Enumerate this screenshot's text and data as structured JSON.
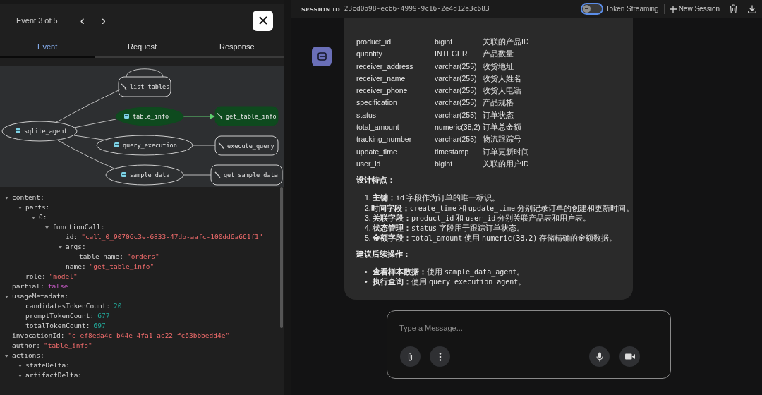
{
  "event_panel": {
    "counter": "Event 3 of 5",
    "prev": "‹",
    "next": "›",
    "tabs": [
      {
        "label": "Event",
        "selected": true
      },
      {
        "label": "Request",
        "selected": false
      },
      {
        "label": "Response",
        "selected": false
      }
    ],
    "graph_nodes": [
      {
        "label": "sqlite_agent",
        "kind": "agent",
        "selected": false
      },
      {
        "label": "list_tables",
        "kind": "tool",
        "selected": false
      },
      {
        "label": "table_info",
        "kind": "agent",
        "selected": true
      },
      {
        "label": "get_table_info",
        "kind": "tool",
        "selected": true
      },
      {
        "label": "query_execution",
        "kind": "agent",
        "selected": false
      },
      {
        "label": "execute_query",
        "kind": "tool",
        "selected": false
      },
      {
        "label": "sample_data",
        "kind": "agent",
        "selected": false
      },
      {
        "label": "get_sample_data",
        "kind": "tool",
        "selected": false
      }
    ],
    "json_tree": [
      {
        "key": "content:",
        "expanded": true,
        "children": [
          {
            "key": "parts:",
            "expanded": true,
            "children": [
              {
                "key": "0:",
                "expanded": true,
                "children": [
                  {
                    "key": "functionCall:",
                    "expanded": true,
                    "children": [
                      {
                        "key": "id:",
                        "value": "\"call_0_90706c3e-6833-47db-aafc-100dd6a661f1\"",
                        "kind": "string"
                      },
                      {
                        "key": "args:",
                        "expanded": true,
                        "children": [
                          {
                            "key": "table_name:",
                            "value": "\"orders\"",
                            "kind": "string"
                          }
                        ]
                      },
                      {
                        "key": "name:",
                        "value": "\"get_table_info\"",
                        "kind": "string"
                      }
                    ]
                  }
                ]
              }
            ]
          },
          {
            "key": "role:",
            "value": "\"model\"",
            "kind": "string"
          }
        ]
      },
      {
        "key": "partial:",
        "value": "false",
        "kind": "boolean"
      },
      {
        "key": "usageMetadata:",
        "expanded": true,
        "children": [
          {
            "key": "candidatesTokenCount:",
            "value": "20",
            "kind": "number"
          },
          {
            "key": "promptTokenCount:",
            "value": "677",
            "kind": "number"
          },
          {
            "key": "totalTokenCount:",
            "value": "697",
            "kind": "number"
          }
        ]
      },
      {
        "key": "invocationId:",
        "value": "\"e-ef8eda4c-b44e-4fa1-ae22-fc63bbbedd4e\"",
        "kind": "string"
      },
      {
        "key": "author:",
        "value": "\"table_info\"",
        "kind": "string"
      },
      {
        "key": "actions:",
        "expanded": true,
        "children": [
          {
            "key": "stateDelta:",
            "expanded": true
          },
          {
            "key": "artifactDelta:",
            "expanded": true
          }
        ]
      }
    ]
  },
  "top_bar": {
    "session_label": "SESSION ID",
    "session_id": "23cd0b98-ecb6-4999-9c16-2e4d12e3c683",
    "token_streaming": {
      "label": "Token Streaming",
      "on": false
    },
    "new_session": "New Session"
  },
  "message": {
    "schema_rows": [
      [
        "product_id",
        "bigint",
        "关联的产品ID"
      ],
      [
        "quantity",
        "INTEGER",
        "产品数量"
      ],
      [
        "receiver_address",
        "varchar(255)",
        "收货地址"
      ],
      [
        "receiver_name",
        "varchar(255)",
        "收货人姓名"
      ],
      [
        "receiver_phone",
        "varchar(255)",
        "收货人电话"
      ],
      [
        "specification",
        "varchar(255)",
        "产品规格"
      ],
      [
        "status",
        "varchar(255)",
        "订单状态"
      ],
      [
        "total_amount",
        "numeric(38,2)",
        "订单总金额"
      ],
      [
        "tracking_number",
        "varchar(255)",
        "物流跟踪号"
      ],
      [
        "update_time",
        "timestamp",
        "订单更新时间"
      ],
      [
        "user_id",
        "bigint",
        "关联的用户ID"
      ]
    ],
    "sections": [
      {
        "heading": "设计特点：",
        "items": [
          {
            "marker": "1.",
            "parts": [
              {
                "kind": "bold",
                "text": "主键："
              },
              {
                "kind": "code",
                "text": "id"
              },
              {
                "kind": "plain",
                "text": " 字段作为订单的唯一标识。"
              }
            ]
          },
          {
            "marker": "2.",
            "parts": [
              {
                "kind": "bold",
                "text": "时间字段："
              },
              {
                "kind": "code",
                "text": "create_time"
              },
              {
                "kind": "plain",
                "text": " 和 "
              },
              {
                "kind": "code",
                "text": "update_time"
              },
              {
                "kind": "plain",
                "text": " 分别记录订单的创建和更新时间。"
              }
            ]
          },
          {
            "marker": "3.",
            "parts": [
              {
                "kind": "bold",
                "text": "关联字段："
              },
              {
                "kind": "code",
                "text": "product_id"
              },
              {
                "kind": "plain",
                "text": " 和 "
              },
              {
                "kind": "code",
                "text": "user_id"
              },
              {
                "kind": "plain",
                "text": " 分别关联产品表和用户表。"
              }
            ]
          },
          {
            "marker": "4.",
            "parts": [
              {
                "kind": "bold",
                "text": "状态管理："
              },
              {
                "kind": "code",
                "text": "status"
              },
              {
                "kind": "plain",
                "text": " 字段用于跟踪订单状态。"
              }
            ]
          },
          {
            "marker": "5.",
            "parts": [
              {
                "kind": "bold",
                "text": "金额字段："
              },
              {
                "kind": "code",
                "text": "total_amount"
              },
              {
                "kind": "plain",
                "text": " 使用 "
              },
              {
                "kind": "code",
                "text": "numeric(38,2)"
              },
              {
                "kind": "plain",
                "text": " 存储精确的金额数据。"
              }
            ]
          }
        ]
      },
      {
        "heading": "建议后续操作：",
        "items": [
          {
            "marker": "•",
            "parts": [
              {
                "kind": "bold",
                "text": "查看样本数据："
              },
              {
                "kind": "plain",
                "text": "使用 "
              },
              {
                "kind": "code",
                "text": "sample_data_agent"
              },
              {
                "kind": "plain",
                "text": "。"
              }
            ]
          },
          {
            "marker": "•",
            "parts": [
              {
                "kind": "bold",
                "text": "执行查询："
              },
              {
                "kind": "plain",
                "text": "使用 "
              },
              {
                "kind": "code",
                "text": "query_execution_agent"
              },
              {
                "kind": "plain",
                "text": "。"
              }
            ]
          }
        ]
      }
    ]
  },
  "composer": {
    "placeholder": "Type a Message..."
  }
}
